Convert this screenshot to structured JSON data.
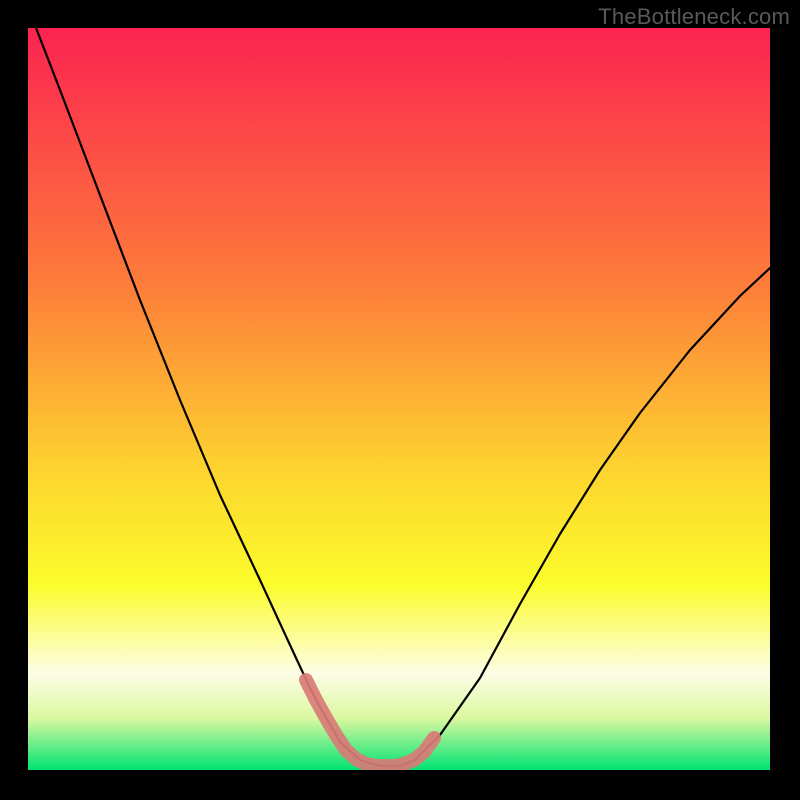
{
  "watermark": {
    "text": "TheBottleneck.com"
  },
  "colors": {
    "background": "#000000",
    "curve_stroke": "#000000",
    "highlight_stroke": "#d97b77",
    "gradient_top": "#fb2351",
    "gradient_mid1": "#fd7b3a",
    "gradient_mid2": "#fdd52f",
    "gradient_mid3": "#fbfc2b",
    "gradient_mid4": "#fdfde6",
    "gradient_mid5": "#dbf8a0",
    "gradient_bottom": "#00e373"
  },
  "chart_data": {
    "type": "line",
    "title": "",
    "xlabel": "",
    "ylabel": "",
    "xlim": [
      28,
      770
    ],
    "ylim": [
      770,
      7
    ],
    "note": "Values are pixel coordinates inside the 800x800 canvas; the visible curve is the black V-shaped line and the pink segment highlights the minimum region. No numeric axis labels are rendered in the image, so x/y are positional only.",
    "series": [
      {
        "name": "bottleneck-curve",
        "x": [
          28,
          60,
          100,
          140,
          180,
          220,
          260,
          290,
          310,
          320,
          340,
          360,
          380,
          400,
          415,
          440,
          480,
          520,
          560,
          600,
          640,
          690,
          740,
          770
        ],
        "y": [
          7,
          90,
          195,
          300,
          400,
          495,
          580,
          645,
          688,
          707,
          742,
          760,
          766,
          766,
          760,
          735,
          678,
          604,
          534,
          470,
          413,
          350,
          296,
          268
        ]
      },
      {
        "name": "optimal-range-highlight",
        "x": [
          306,
          316,
          326,
          336,
          346,
          356,
          366,
          376,
          386,
          396,
          404,
          414,
          424,
          434
        ],
        "y": [
          680,
          700,
          718,
          735,
          750,
          759,
          764,
          766,
          766,
          766,
          764,
          760,
          752,
          738
        ]
      }
    ]
  }
}
